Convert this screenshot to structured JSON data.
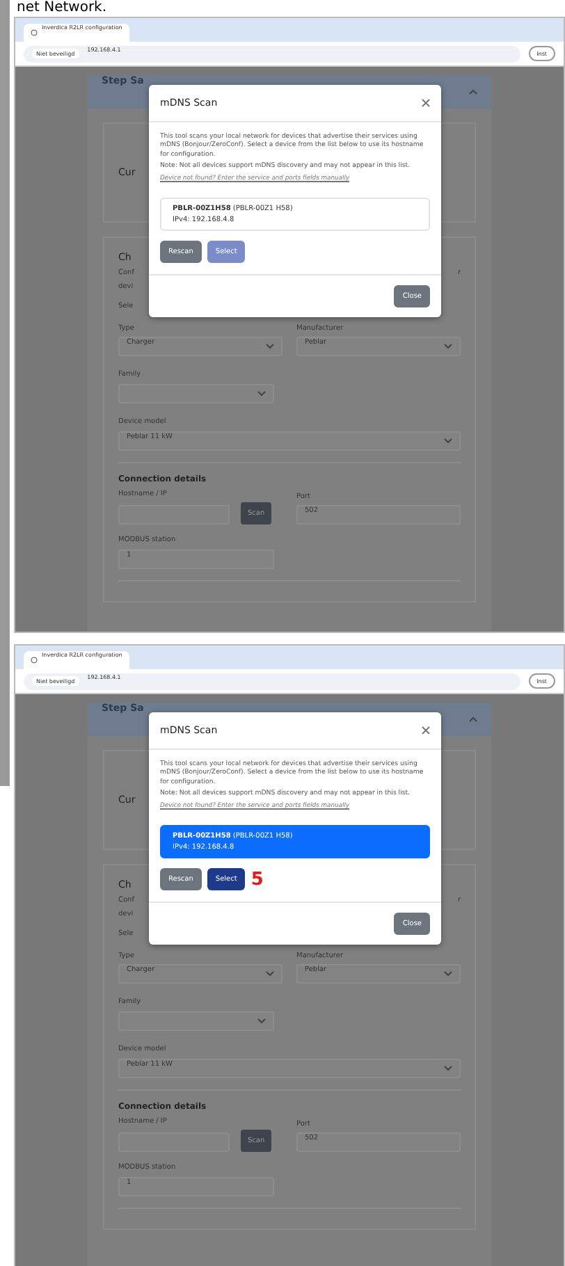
{
  "heading": "net Network.",
  "screenshots": [
    {
      "browser": {
        "tab_title": "Inverdica R2LR configuration",
        "security_label": "Niet beveiligd",
        "url": "192.168.4.1",
        "profile_label": "Inst"
      },
      "page": {
        "step_title": "Step Sa",
        "card_title": "Cur",
        "section_title": "Ch",
        "intro_start": "Conf",
        "intro_end": "r",
        "intro_second": "devi",
        "select_label": "Sele",
        "type_label": "Type",
        "type_value": "Charger",
        "manufacturer_label": "Manufacturer",
        "manufacturer_value": "Peblar",
        "family_label": "Family",
        "model_label": "Device model",
        "model_value": "Peblar 11 kW",
        "connection_title": "Connection details",
        "host_label": "Hostname / IP",
        "scan_label": "Scan",
        "port_label": "Port",
        "port_value": "502",
        "station_label": "MODBUS station",
        "station_value": "1"
      },
      "dialog": {
        "title": "mDNS Scan",
        "description": "This tool scans your local network for devices that advertise their services using mDNS (Bonjour/ZeroConf). Select a device from the list below to use its hostname for configuration.",
        "note": "Note: Not all devices support mDNS discovery and may not appear in this list.",
        "hint": "Device not found? Enter the service and ports fields manually",
        "devices": [
          {
            "name": "PBLR-00Z1H58",
            "alias": "(PBLR-00Z1 H58)",
            "address": "IPv4: 192.168.4.8",
            "selected": false
          }
        ],
        "buttons": [
          {
            "label": "Rescan",
            "disabled": false
          },
          {
            "label": "Select",
            "disabled": true
          }
        ],
        "close_label": "Close"
      }
    },
    {
      "browser": {
        "tab_title": "Inverdica R2LR configuration",
        "security_label": "Niet beveiligd",
        "url": "192.168.4.1",
        "profile_label": "Inst"
      },
      "page": {
        "step_title": "Step Sa",
        "card_title": "Cur",
        "section_title": "Ch",
        "intro_start": "Conf",
        "intro_end": "r",
        "intro_second": "devi",
        "select_label": "Sele",
        "type_label": "Type",
        "type_value": "Charger",
        "manufacturer_label": "Manufacturer",
        "manufacturer_value": "Peblar",
        "family_label": "Family",
        "model_label": "Device model",
        "model_value": "Peblar 11 kW",
        "connection_title": "Connection details",
        "host_label": "Hostname / IP",
        "scan_label": "Scan",
        "port_label": "Port",
        "port_value": "502",
        "station_label": "MODBUS station",
        "station_value": "1"
      },
      "dialog": {
        "title": "mDNS Scan",
        "description": "This tool scans your local network for devices that advertise their services using mDNS (Bonjour/ZeroConf). Select a device from the list below to use its hostname for configuration.",
        "note": "Note: Not all devices support mDNS discovery and may not appear in this list.",
        "hint": "Device not found? Enter the service and ports fields manually",
        "devices": [
          {
            "name": "PBLR-00Z1H58",
            "alias": "(PBLR-00Z1 H58)",
            "address": "IPv4: 192.168.4.8",
            "selected": true
          }
        ],
        "buttons": [
          {
            "label": "Rescan",
            "disabled": false
          },
          {
            "label": "Select",
            "disabled": false
          }
        ],
        "close_label": "Close",
        "annotation": "5"
      }
    }
  ]
}
